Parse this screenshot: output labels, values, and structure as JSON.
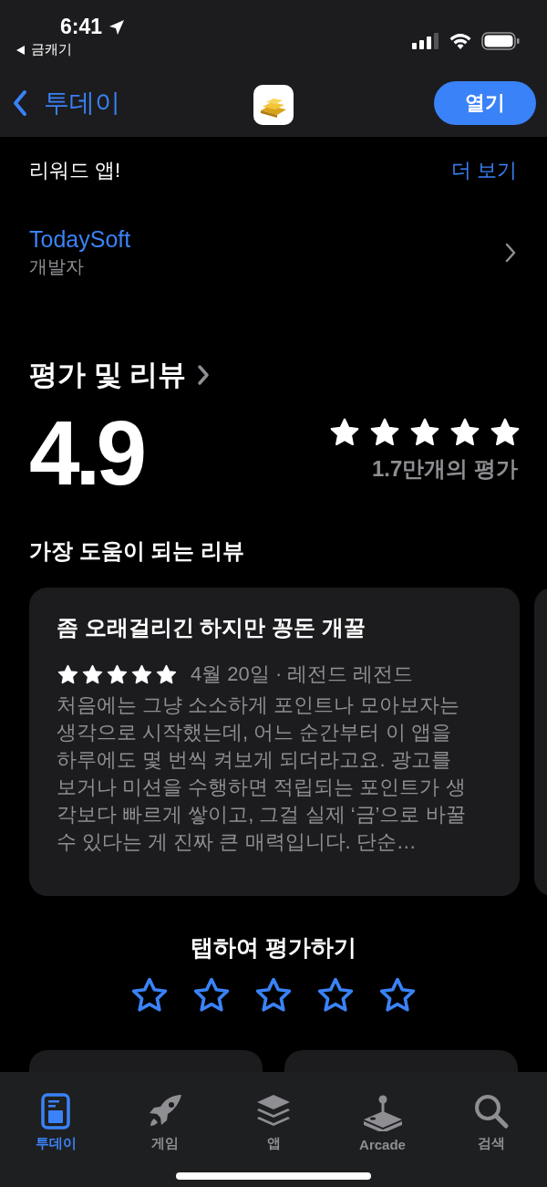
{
  "status_bar": {
    "time": "6:41",
    "back_app": "금캐기"
  },
  "nav": {
    "back_label": "투데이",
    "open_button": "열기"
  },
  "description": {
    "last_line": "리워드 앱!",
    "more_link": "더 보기"
  },
  "developer": {
    "name": "TodaySoft",
    "role": "개발자"
  },
  "ratings": {
    "heading": "평가 및 리뷰",
    "score": "4.9",
    "stars": 5,
    "count": "1.7만개의 평가"
  },
  "helpful_reviews": {
    "heading": "가장 도움이 되는 리뷰",
    "reviews": [
      {
        "title": "좀 오래걸리긴 하지만 꽁돈 개꿀",
        "stars": 5,
        "meta": "4월 20일 · 레전드 레전드",
        "body": "처음에는 그냥 소소하게 포인트나 모아보자는 생각으로 시작했는데, 어느 순간부터 이 앱을 하루에도 몇 번씩 켜보게 되더라고요. 광고를 보거나 미션을 수행하면 적립되는 포인트가 생각보다 빠르게 쌓이고, 그걸 실제 ‘금’으로 바꿀 수 있다는 게 진짜 큰 매력입니다. 단순…"
      }
    ]
  },
  "tap_to_rate": {
    "label": "탭하여 평가하기",
    "stars": 0
  },
  "tab_bar": [
    {
      "label": "투데이",
      "kind": "today",
      "selected": true
    },
    {
      "label": "게임",
      "kind": "games",
      "selected": false
    },
    {
      "label": "앱",
      "kind": "apps",
      "selected": false
    },
    {
      "label": "Arcade",
      "kind": "arcade",
      "selected": false
    },
    {
      "label": "검색",
      "kind": "search",
      "selected": false
    }
  ]
}
